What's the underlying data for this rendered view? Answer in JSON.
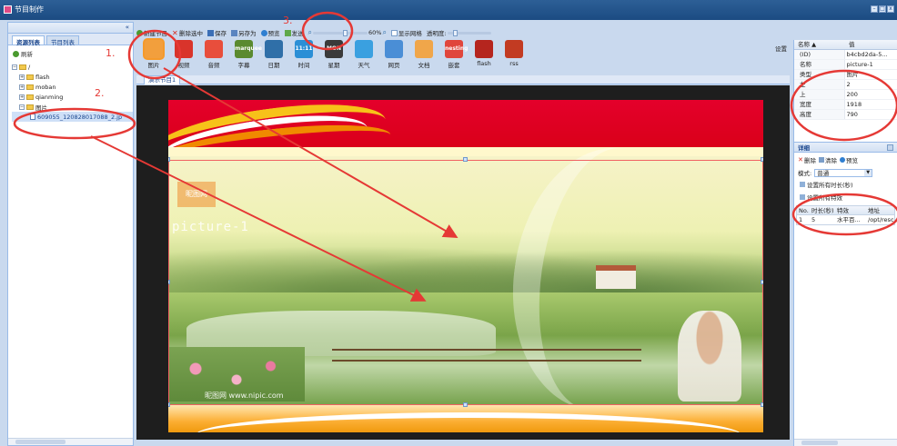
{
  "window": {
    "title": "节目制作",
    "buttons": [
      "–",
      "□",
      "x"
    ]
  },
  "left_panel": {
    "collapse_glyph": "«",
    "tabs": [
      {
        "label": "资源列表",
        "active": true
      },
      {
        "label": "节目列表",
        "active": false
      }
    ],
    "refresh_label": "刷新",
    "tree": {
      "root": "/",
      "folders": [
        "flash",
        "moban",
        "qianming",
        "图片"
      ],
      "selected_file": "609055_120828017088_2.jp"
    }
  },
  "toolbar": {
    "new": "新建节目",
    "delete_selected": "删除选中",
    "save": "保存",
    "save_as": "另存为",
    "preview": "预览",
    "send": "发送",
    "zoom_percent": "60%",
    "zoom_value": 0.6,
    "show_grid": "显示网格",
    "opacity": "透明度:"
  },
  "components": [
    {
      "label": "图片",
      "icon": "image-icon",
      "color": "#f29f3d",
      "text": "",
      "selected": true
    },
    {
      "label": "视频",
      "icon": "video-icon",
      "color": "#d9342b",
      "text": "",
      "selected": false
    },
    {
      "label": "音频",
      "icon": "music-icon",
      "color": "#e84e3c",
      "text": "",
      "selected": false
    },
    {
      "label": "字幕",
      "icon": "subtitle-icon",
      "color": "#5a8a2f",
      "text": "marquee",
      "selected": false
    },
    {
      "label": "日期",
      "icon": "calendar-icon",
      "color": "#2f6fa8",
      "text": "",
      "selected": false
    },
    {
      "label": "时间",
      "icon": "clock-icon",
      "color": "#2b8fd6",
      "text": "11:11",
      "selected": false
    },
    {
      "label": "星期",
      "icon": "weekday-icon",
      "color": "#3a3a3a",
      "text": "MON",
      "selected": false
    },
    {
      "label": "天气",
      "icon": "weather-icon",
      "color": "#3aa0e0",
      "text": "",
      "selected": false
    },
    {
      "label": "网页",
      "icon": "webpage-icon",
      "color": "#4a8ed6",
      "text": "",
      "selected": false
    },
    {
      "label": "文档",
      "icon": "document-icon",
      "color": "#f0a64a",
      "text": "",
      "selected": false
    },
    {
      "label": "嵌套",
      "icon": "nested-icon",
      "color": "#e0463c",
      "text": "nesting",
      "selected": false
    },
    {
      "label": "flash",
      "icon": "flash-icon",
      "color": "#b5251e",
      "text": "",
      "selected": false
    },
    {
      "label": "rss",
      "icon": "rss-icon",
      "color": "#c23b22",
      "text": "",
      "selected": false
    }
  ],
  "settings_label": "设置",
  "stage": {
    "tab_label": "演示节目1",
    "watermark": "picture-1",
    "logo_text": "昵图网",
    "credit": "昵图网 www.nipic.com"
  },
  "properties": {
    "header": {
      "name": "名称 ▲",
      "value": "值"
    },
    "rows": [
      {
        "key": "(ID)",
        "value": "b4cbd2da-5..."
      },
      {
        "key": "名称",
        "value": "picture-1"
      },
      {
        "key": "类型",
        "value": "图片"
      },
      {
        "key": "左",
        "value": "2"
      },
      {
        "key": "上",
        "value": "200"
      },
      {
        "key": "宽度",
        "value": "1918"
      },
      {
        "key": "高度",
        "value": "790"
      }
    ]
  },
  "detail": {
    "title": "详细",
    "actions": [
      "删除",
      "清除",
      "预览"
    ],
    "style_label": "模式:",
    "style_value": "普通",
    "set_duration": "设置所有时长(秒)",
    "set_effect": "设置所有特效",
    "table_headers": [
      "No.",
      "时长(秒)",
      "特效",
      "地址"
    ],
    "rows": [
      {
        "no": "1",
        "duration": "5",
        "effect": "水平百...",
        "path": "/opt/resou"
      }
    ]
  },
  "annotations": [
    "1.",
    "2.",
    "3."
  ],
  "colors": {
    "accent": "#15428b",
    "annotation": "#e53935",
    "panel_border": "#99bbe8"
  }
}
